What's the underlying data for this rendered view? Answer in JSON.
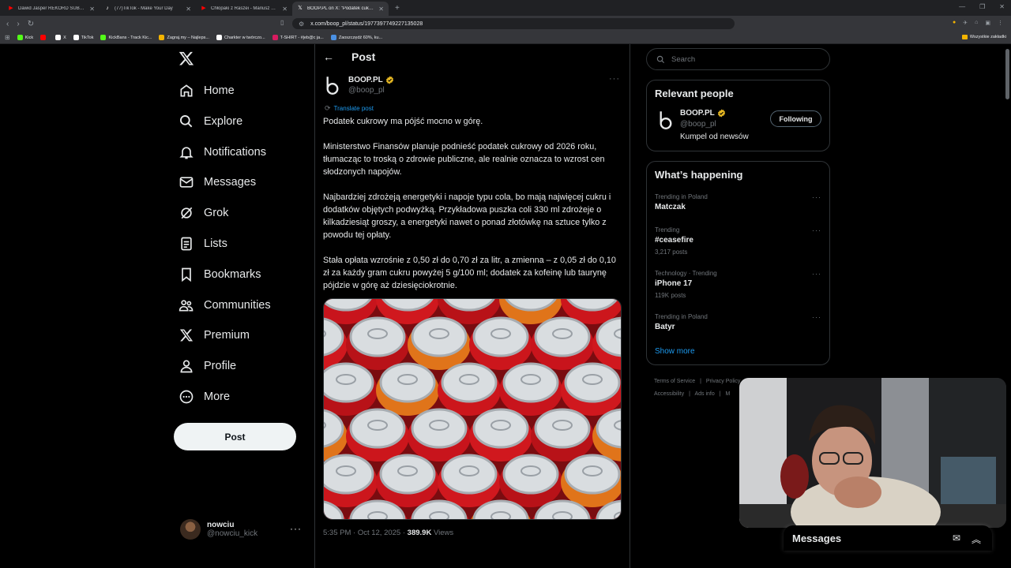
{
  "browser": {
    "tabs": [
      {
        "title": "Dawid Jasper REKORD SUBÓW, PRO",
        "favicon": "youtube-icon",
        "color": "#ff0000",
        "active": false
      },
      {
        "title": "(77)TikTok - Make Your Day",
        "favicon": "tiktok-icon",
        "color": "#ffffff",
        "active": false
      },
      {
        "title": "Chłopaki z Raszei - Mariusz wsd kaji",
        "favicon": "youtube-icon",
        "color": "#ff0000",
        "active": false
      },
      {
        "title": "BOOP.PL on X: \"Podatek cukrow",
        "favicon": "x-icon",
        "color": "#ffffff",
        "active": true
      }
    ],
    "url": "x.com/boop_pl/status/1977397749227135028",
    "bookmarks": [
      {
        "label": "Kick",
        "color": "#53fc18"
      },
      {
        "label": "",
        "color": "#ff0000"
      },
      {
        "label": "X",
        "color": "#ffffff"
      },
      {
        "label": "TikTok",
        "color": "#ffffff"
      },
      {
        "label": "KickBans - Track Kic...",
        "color": "#53fc18"
      },
      {
        "label": "Zagraj.my – Najleps...",
        "color": "#f4b400"
      },
      {
        "label": "Charkter w twórczo...",
        "color": "#ffffff"
      },
      {
        "label": "T-SHIRT - #jeb@c ja...",
        "color": "#d81b60"
      },
      {
        "label": "Zaoszczędź 60%, ku...",
        "color": "#4a90e2"
      }
    ],
    "bookmarks_right": "Wszystkie zakładki"
  },
  "nav": {
    "items": [
      {
        "label": "Home",
        "icon": "home-icon"
      },
      {
        "label": "Explore",
        "icon": "search-icon"
      },
      {
        "label": "Notifications",
        "icon": "bell-icon"
      },
      {
        "label": "Messages",
        "icon": "mail-icon"
      },
      {
        "label": "Grok",
        "icon": "grok-icon"
      },
      {
        "label": "Lists",
        "icon": "list-icon"
      },
      {
        "label": "Bookmarks",
        "icon": "bookmark-icon"
      },
      {
        "label": "Communities",
        "icon": "communities-icon"
      },
      {
        "label": "Premium",
        "icon": "x-icon"
      },
      {
        "label": "Profile",
        "icon": "person-icon"
      },
      {
        "label": "More",
        "icon": "more-circle-icon"
      }
    ],
    "post_label": "Post",
    "account": {
      "name": "nowciu",
      "handle": "@nowciu_kick"
    }
  },
  "post": {
    "header": "Post",
    "author_name": "BOOP.PL",
    "author_handle": "@boop_pl",
    "translate": "Translate post",
    "paragraphs": [
      "Podatek cukrowy ma pójść mocno w górę.",
      "Ministerstwo Finansów planuje podnieść podatek cukrowy od 2026 roku, tłumacząc to troską o zdrowie publiczne, ale realnie oznacza to wzrost cen słodzonych napojów.",
      "Najbardziej zdrożeją energetyki i napoje typu cola, bo mają najwięcej cukru i dodatków objętych podwyżką. Przykładowa puszka coli 330 ml zdrożeje o kilkadziesiąt groszy, a energetyki nawet o ponad złotówkę na sztuce tylko z powodu tej opłaty.",
      "Stała opłata wzrośnie z 0,50 zł do 0,70 zł za litr, a zmienna – z 0,05 zł do 0,10 zł za każdy gram cukru powyżej 5 g/100 ml; dodatek za kofeinę lub taurynę pójdzie w górę aż dziesięciokrotnie."
    ],
    "timestamp": "5:35 PM · Oct 12, 2025 · ",
    "views": "389.9K",
    "views_label": " Views"
  },
  "sidebar": {
    "search_placeholder": "Search",
    "relevant_title": "Relevant people",
    "person": {
      "name": "BOOP.PL",
      "handle": "@boop_pl",
      "bio": "Kumpel od newsów",
      "button": "Following"
    },
    "happening_title": "What’s happening",
    "trends": [
      {
        "category": "Trending in Poland",
        "title": "Matczak",
        "count": ""
      },
      {
        "category": "Trending",
        "title": "#ceasefire",
        "count": "3,217 posts"
      },
      {
        "category": "Technology · Trending",
        "title": "iPhone 17",
        "count": "119K posts"
      },
      {
        "category": "Trending in Poland",
        "title": "Batyr",
        "count": ""
      }
    ],
    "show_more": "Show more",
    "footer": [
      "Terms of Service",
      "|",
      "Privacy Policy",
      "Accessibility",
      "|",
      "Ads info",
      "|",
      "M"
    ]
  },
  "dock": {
    "title": "Messages"
  },
  "colors": {
    "accent": "#1d9bf0",
    "verified": "#e8b923",
    "background": "#000000",
    "border": "#2f3336"
  }
}
